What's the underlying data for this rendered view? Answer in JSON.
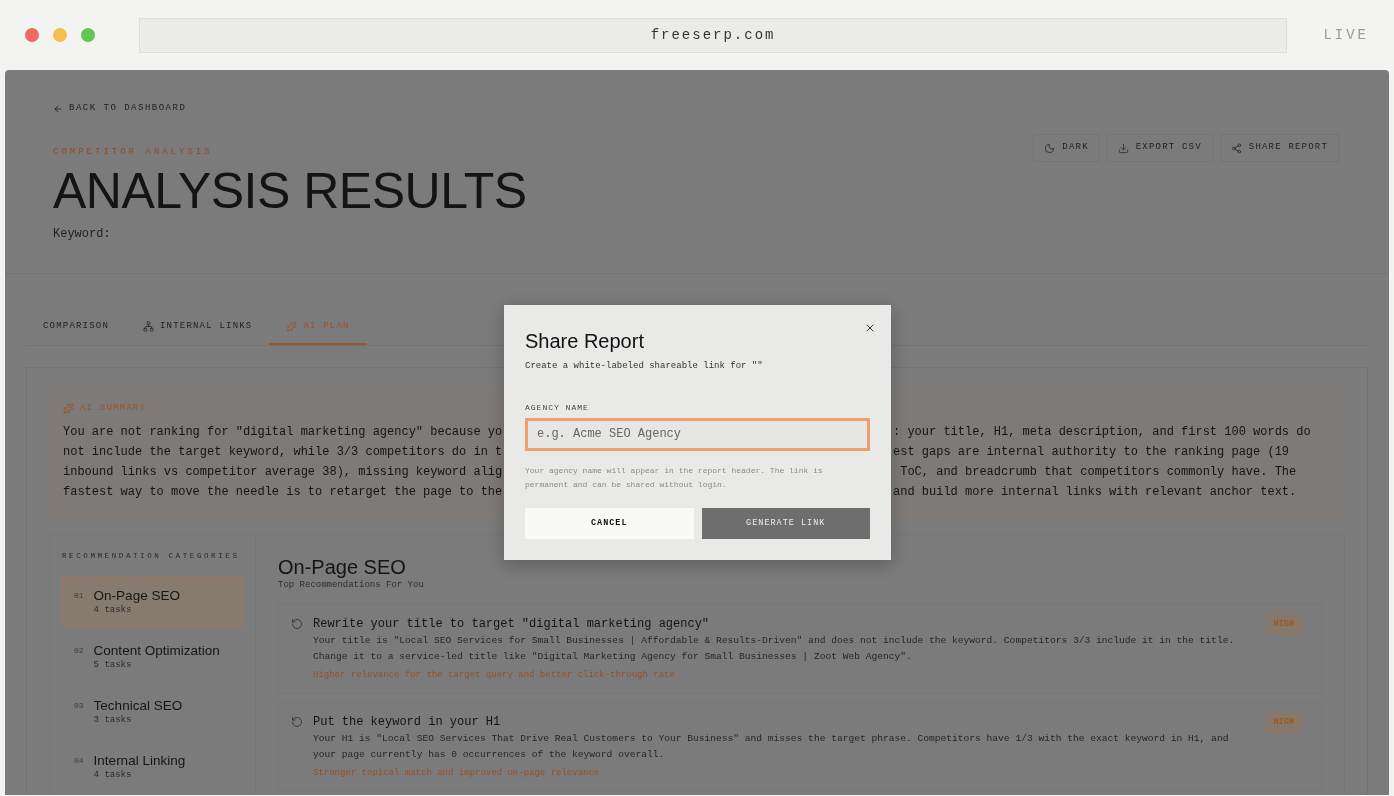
{
  "browser": {
    "url": "freeserp.com",
    "status": "LIVE"
  },
  "header": {
    "back_link": "BACK TO DASHBOARD",
    "eyebrow": "COMPETITOR ANALYSIS",
    "title": "ANALYSIS RESULTS",
    "keyword_label": "Keyword:",
    "actions": [
      {
        "label": "DARK",
        "kind": "moon"
      },
      {
        "label": "EXPORT CSV",
        "kind": "download"
      },
      {
        "label": "SHARE REPORT",
        "kind": "share"
      }
    ]
  },
  "tabs": [
    {
      "label": "COMPARISON",
      "selected": false,
      "kind": "plain"
    },
    {
      "label": "INTERNAL LINKS",
      "selected": false,
      "kind": "network"
    },
    {
      "label": "AI PLAN",
      "selected": true,
      "kind": "sparkle"
    }
  ],
  "summary": {
    "heading": "AI SUMMARY",
    "lines": [
      {
        "left": "You are not ranking for \"digital marketing agency\" because yo",
        "right": ": your title, H1, meta description, and first 100 words do"
      },
      {
        "left": "not include the target keyword, while 3/3 competitors do in t",
        "right": "est gaps are internal authority to the ranking page (19"
      },
      {
        "left": "inbound links vs competitor average 38), missing keyword alig",
        "right": " ToC, and breadcrumb that competitors commonly have. The"
      },
      {
        "left": "fastest way to move the needle is to retarget the page to the",
        "right": "and build more internal links with relevant anchor text."
      }
    ]
  },
  "categories": {
    "heading": "RECOMMENDATION CATEGORIES",
    "items": [
      {
        "number": "01",
        "name": "On-Page SEO",
        "count": "4 tasks",
        "selected": true
      },
      {
        "number": "02",
        "name": "Content Optimization",
        "count": "5 tasks",
        "selected": false
      },
      {
        "number": "03",
        "name": "Technical SEO",
        "count": "3 tasks",
        "selected": false
      },
      {
        "number": "04",
        "name": "Internal Linking",
        "count": "4 tasks",
        "selected": false
      }
    ]
  },
  "section": {
    "title": "On-Page SEO",
    "subtitle": "Top Recommendations For You",
    "recommendations": [
      {
        "title": "Rewrite your title to target \"digital marketing agency\"",
        "description": "Your title is \"Local SEO Services for Small Businesses | Affordable & Results-Driven\" and does not include the keyword. Competitors 3/3 include it in the title. Change it to a service-led title like \"Digital Marketing Agency for Small Businesses | Zoot Web Agency\".",
        "impact": "Higher relevance for the target query and better click-through rate",
        "priority": "HIGH"
      },
      {
        "title": "Put the keyword in your H1",
        "description": "Your H1 is \"Local SEO Services That Drive Real Customers to Your Business\" and misses the target phrase. Competitors have 1/3 with the exact keyword in H1, and your page currently has 0 occurrences of the keyword overall.",
        "impact": "Stronger topical match and improved on-page relevance",
        "priority": "HIGH"
      }
    ]
  },
  "dialog": {
    "title": "Share Report",
    "description": "Create a white-labeled shareable link for \"\"",
    "field_label": "AGENCY NAME",
    "placeholder": "e.g. Acme SEO Agency",
    "focused": true,
    "help": "Your agency name will appear in the report header. The link is permanent and can be shared without login.",
    "buttons": [
      {
        "label": "CANCEL",
        "kind": "secondary"
      },
      {
        "label": "GENERATE LINK",
        "kind": "primary"
      }
    ]
  }
}
